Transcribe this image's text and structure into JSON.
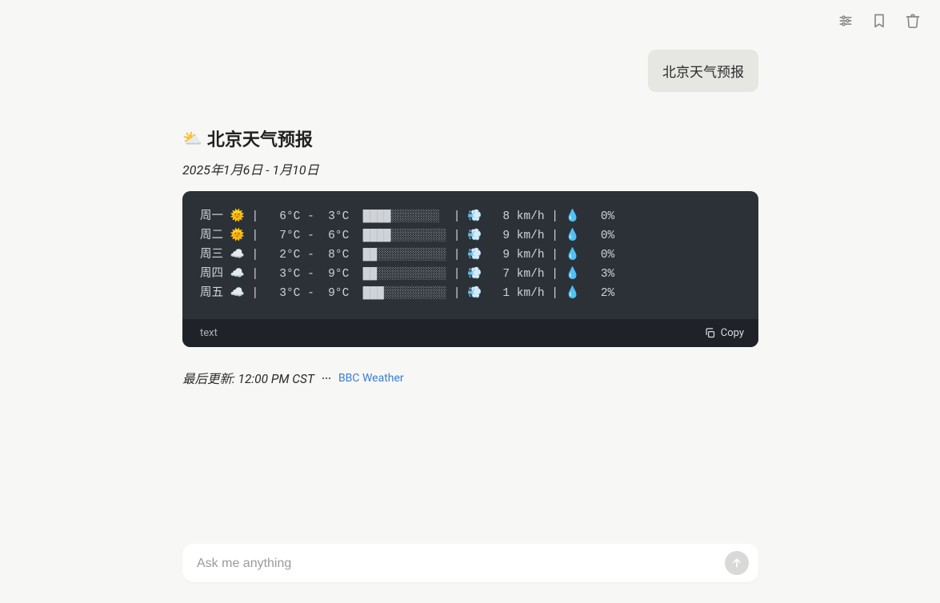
{
  "user_message": "北京天气预报",
  "assistant": {
    "heading_emoji": "⛅",
    "heading_text": "北京天气预报",
    "date_range": "2025年1月6日 - 1月10日",
    "code_lang_label": "text",
    "copy_label": "Copy",
    "last_update_label": "最后更新: 12:00 PM CST",
    "source_name": "BBC Weather"
  },
  "forecast": [
    {
      "day": "周一",
      "cond": "🌞",
      "hi": "6°C",
      "lo": "3°C",
      "bar_solid": 4,
      "bar_shade": 7,
      "wind_icon": "💨",
      "wind": "8 km/h",
      "hum_icon": "💧",
      "hum": "0%"
    },
    {
      "day": "周二",
      "cond": "🌞",
      "hi": "7°C",
      "lo": "6°C",
      "bar_solid": 4,
      "bar_shade": 8,
      "wind_icon": "💨",
      "wind": "9 km/h",
      "hum_icon": "💧",
      "hum": "0%"
    },
    {
      "day": "周三",
      "cond": "☁️",
      "hi": "2°C",
      "lo": "8°C",
      "bar_solid": 2,
      "bar_shade": 10,
      "wind_icon": "💨",
      "wind": "9 km/h",
      "hum_icon": "💧",
      "hum": "0%"
    },
    {
      "day": "周四",
      "cond": "☁️",
      "hi": "3°C",
      "lo": "9°C",
      "bar_solid": 2,
      "bar_shade": 10,
      "wind_icon": "💨",
      "wind": "7 km/h",
      "hum_icon": "💧",
      "hum": "3%"
    },
    {
      "day": "周五",
      "cond": "☁️",
      "hi": "3°C",
      "lo": "9°C",
      "bar_solid": 3,
      "bar_shade": 9,
      "wind_icon": "💨",
      "wind": "1 km/h",
      "hum_icon": "💧",
      "hum": "2%"
    }
  ],
  "composer": {
    "placeholder": "Ask me anything"
  }
}
